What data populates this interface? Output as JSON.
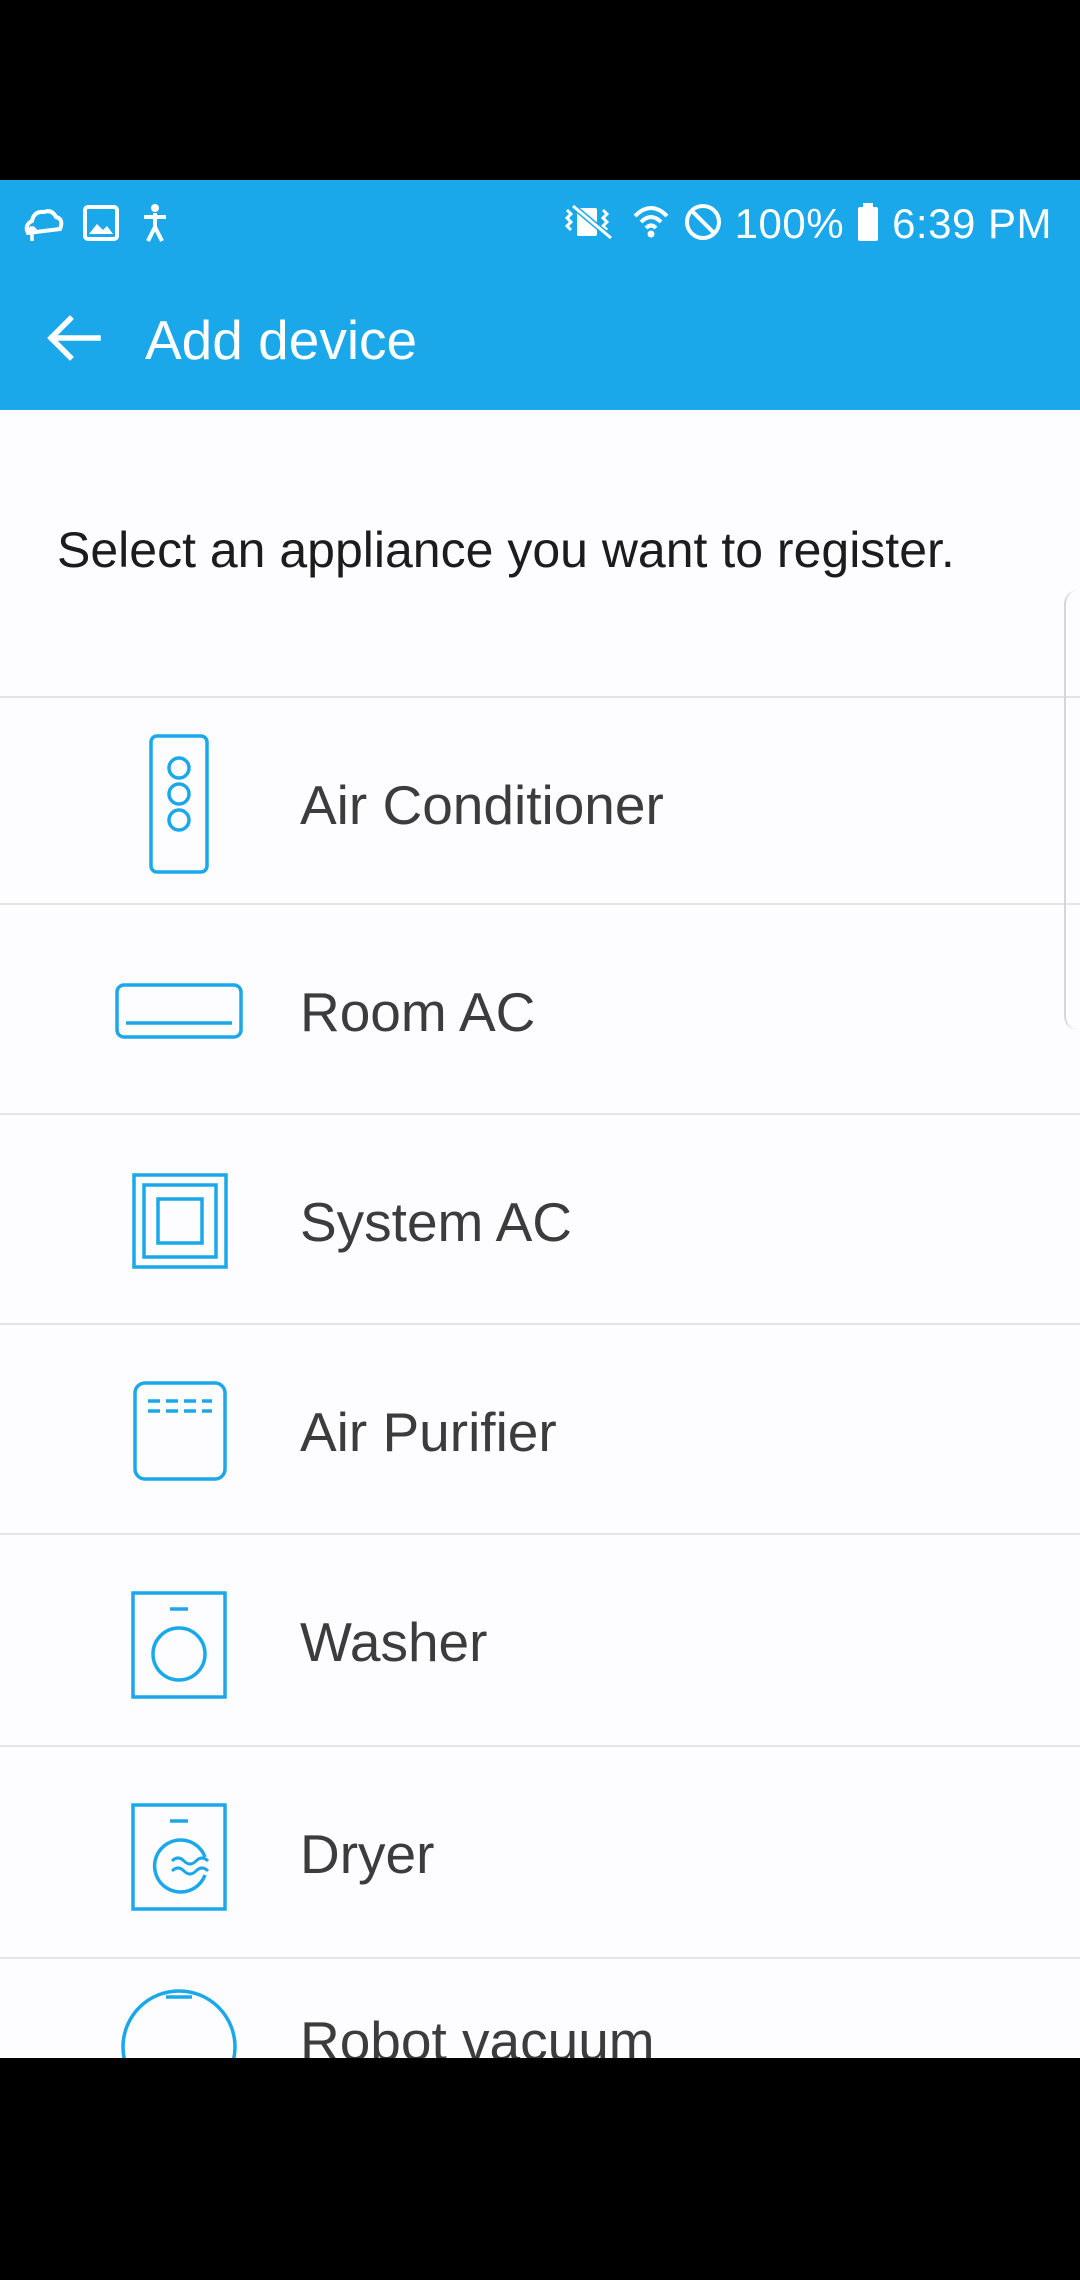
{
  "status_bar": {
    "battery": "100%",
    "time": "6:39 PM",
    "left_icons": [
      "cloud-sync-icon",
      "image-icon",
      "accessibility-icon"
    ],
    "right_icons": [
      "vibrate-mute-icon",
      "wifi-icon",
      "do-not-disturb-icon",
      "battery-icon"
    ]
  },
  "app_bar": {
    "title": "Add device",
    "back_icon": "arrow-left-icon"
  },
  "instruction": "Select an appliance you want to register.",
  "appliances": [
    {
      "label": "Air Conditioner",
      "icon": "air-conditioner-icon"
    },
    {
      "label": "Room AC",
      "icon": "room-ac-icon"
    },
    {
      "label": "System AC",
      "icon": "system-ac-icon"
    },
    {
      "label": "Air Purifier",
      "icon": "air-purifier-icon"
    },
    {
      "label": "Washer",
      "icon": "washer-icon"
    },
    {
      "label": "Dryer",
      "icon": "dryer-icon"
    },
    {
      "label": "Robot vacuum",
      "icon": "robot-vacuum-icon"
    }
  ],
  "colors": {
    "accent": "#1aa8ea",
    "icon_stroke": "#1aa8ea",
    "background": "#fdfcfe",
    "divider": "#e4e4e6",
    "label_text": "#3c3c3c"
  }
}
